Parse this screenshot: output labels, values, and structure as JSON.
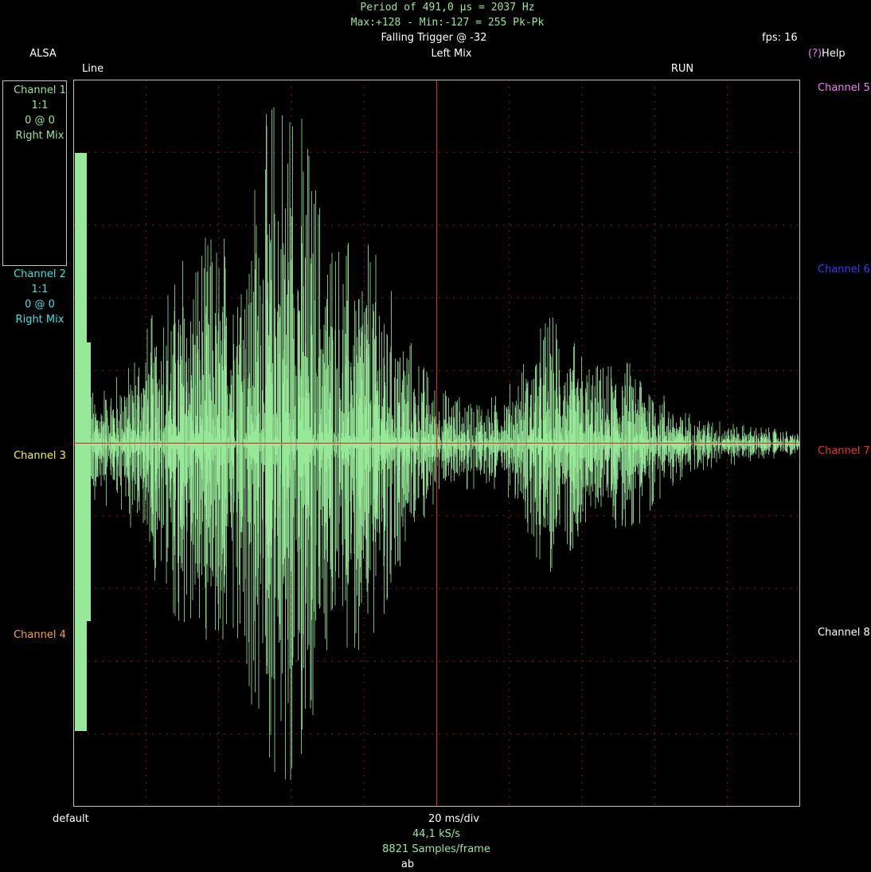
{
  "top": {
    "period_line": "Period of 491,0 µs =  2037 Hz",
    "maxmin_line": "Max:+128 - Min:-127 = 255 Pk-Pk",
    "trigger": "Falling Trigger @ -32",
    "fps": "fps: 16",
    "source": "ALSA",
    "mix": "Left Mix",
    "help_prefix": "(?)",
    "help": "Help",
    "line_mode": "Line",
    "run_state": "RUN"
  },
  "left_channels": [
    {
      "name": "Channel 1",
      "scale": "1:1",
      "offset": "0 @ 0",
      "source": "Right Mix",
      "color": "#98e89a"
    },
    {
      "name": "Channel 2",
      "scale": "1:1",
      "offset": "0 @ 0",
      "source": "Right Mix",
      "color": "#3fe0e0"
    },
    {
      "name": "Channel 3",
      "color": "#f2f24a"
    },
    {
      "name": "Channel 4",
      "color": "#f4a040"
    }
  ],
  "right_channels": [
    {
      "name": "Channel 5",
      "color": "#f080f0"
    },
    {
      "name": "Channel 6",
      "color": "#3a3af0"
    },
    {
      "name": "Channel 7",
      "color": "#f03030"
    },
    {
      "name": "Channel 8",
      "color": "#ffffff"
    }
  ],
  "bottom": {
    "preset": "default",
    "timebase": "20 ms/div",
    "sample_rate": "44,1 kS/s",
    "samples": "8821 Samples/frame",
    "label": "ab"
  },
  "colors": {
    "trace": "#98e89a",
    "grid": "#8a1414",
    "cursor": "#e02020",
    "frame": "#bdbdbd"
  },
  "grid": {
    "divisions": 10,
    "subdivisions": 5
  }
}
